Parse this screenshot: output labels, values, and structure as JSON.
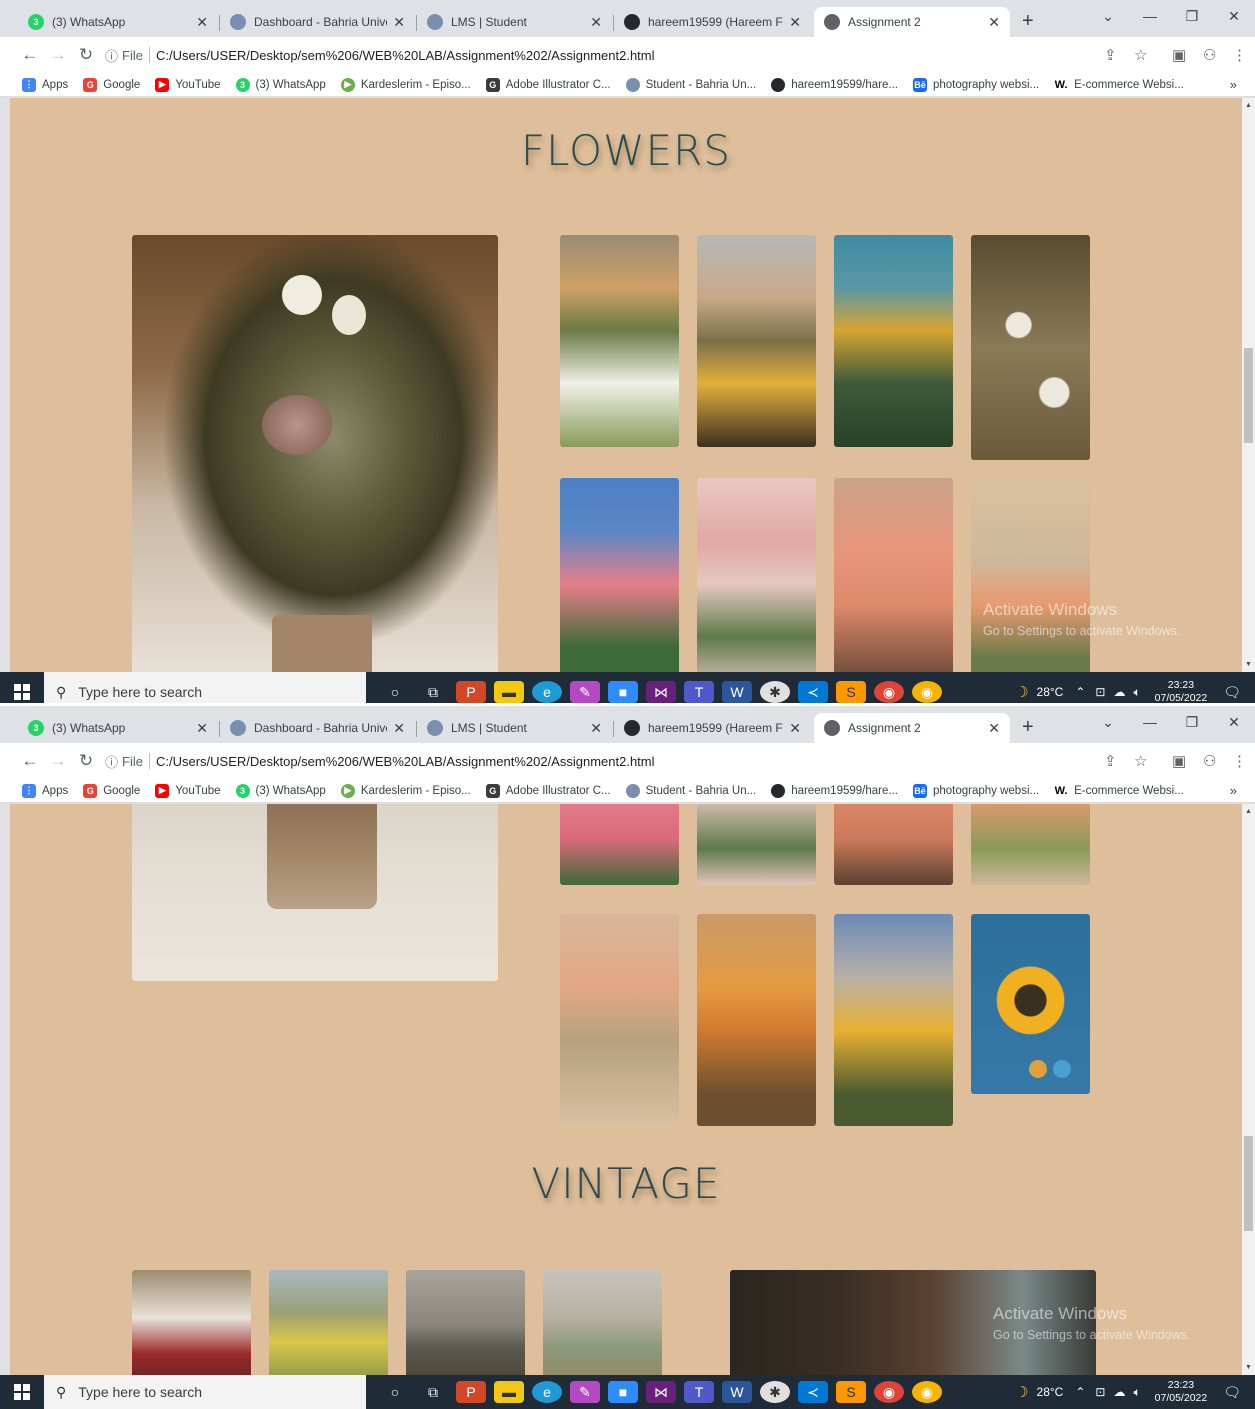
{
  "browser": {
    "tabs": [
      {
        "title": "(3) WhatsApp",
        "icon": "whatsapp-icon",
        "color": "#25d366",
        "badge": "3"
      },
      {
        "title": "Dashboard - Bahria Universit",
        "icon": "bahria-icon",
        "color": "#7a8fb0",
        "badge": ""
      },
      {
        "title": "LMS | Student",
        "icon": "bahria-icon",
        "color": "#7a8fb0",
        "badge": ""
      },
      {
        "title": "hareem19599 (Hareem Fatim",
        "icon": "github-icon",
        "color": "#24292e",
        "badge": ""
      },
      {
        "title": "Assignment 2",
        "icon": "globe-icon",
        "color": "#5f6368",
        "badge": ""
      }
    ],
    "new_tab": "+",
    "address": {
      "scheme_label": "File",
      "url": "C:/Users/USER/Desktop/sem%206/WEB%20LAB/Assignment%202/Assignment2.html"
    },
    "bookmarks": [
      {
        "label": "Apps",
        "icon": "apps-grid-icon",
        "color": "#4285f4"
      },
      {
        "label": "Google",
        "icon": "google-icon",
        "color": "#ea4335"
      },
      {
        "label": "YouTube",
        "icon": "youtube-icon",
        "color": "#ff0000"
      },
      {
        "label": "(3) WhatsApp",
        "icon": "whatsapp-icon",
        "color": "#25d366"
      },
      {
        "label": "Kardeslerim - Episo...",
        "icon": "play-icon",
        "color": "#6ab04c"
      },
      {
        "label": "Adobe Illustrator C...",
        "icon": "g-icon",
        "color": "#3c3c3c"
      },
      {
        "label": "Student - Bahria Un...",
        "icon": "bahria-icon",
        "color": "#7a8fb0"
      },
      {
        "label": "hareem19599/hare...",
        "icon": "github-icon",
        "color": "#24292e"
      },
      {
        "label": "photography websi...",
        "icon": "behance-icon",
        "color": "#1769ff"
      },
      {
        "label": "E-commerce Websi...",
        "icon": "w-icon",
        "color": "#000000"
      }
    ],
    "bookmarks_more": "»"
  },
  "page": {
    "flowers_title": "FLOWERS",
    "vintage_title": "VINTAGE"
  },
  "watermark": {
    "line1": "Activate Windows",
    "line2": "Go to Settings to activate Windows."
  },
  "taskbar": {
    "search_placeholder": "Type here to search",
    "weather": "28°C",
    "time": "23:23",
    "date": "07/05/2022",
    "notifications": "1"
  }
}
